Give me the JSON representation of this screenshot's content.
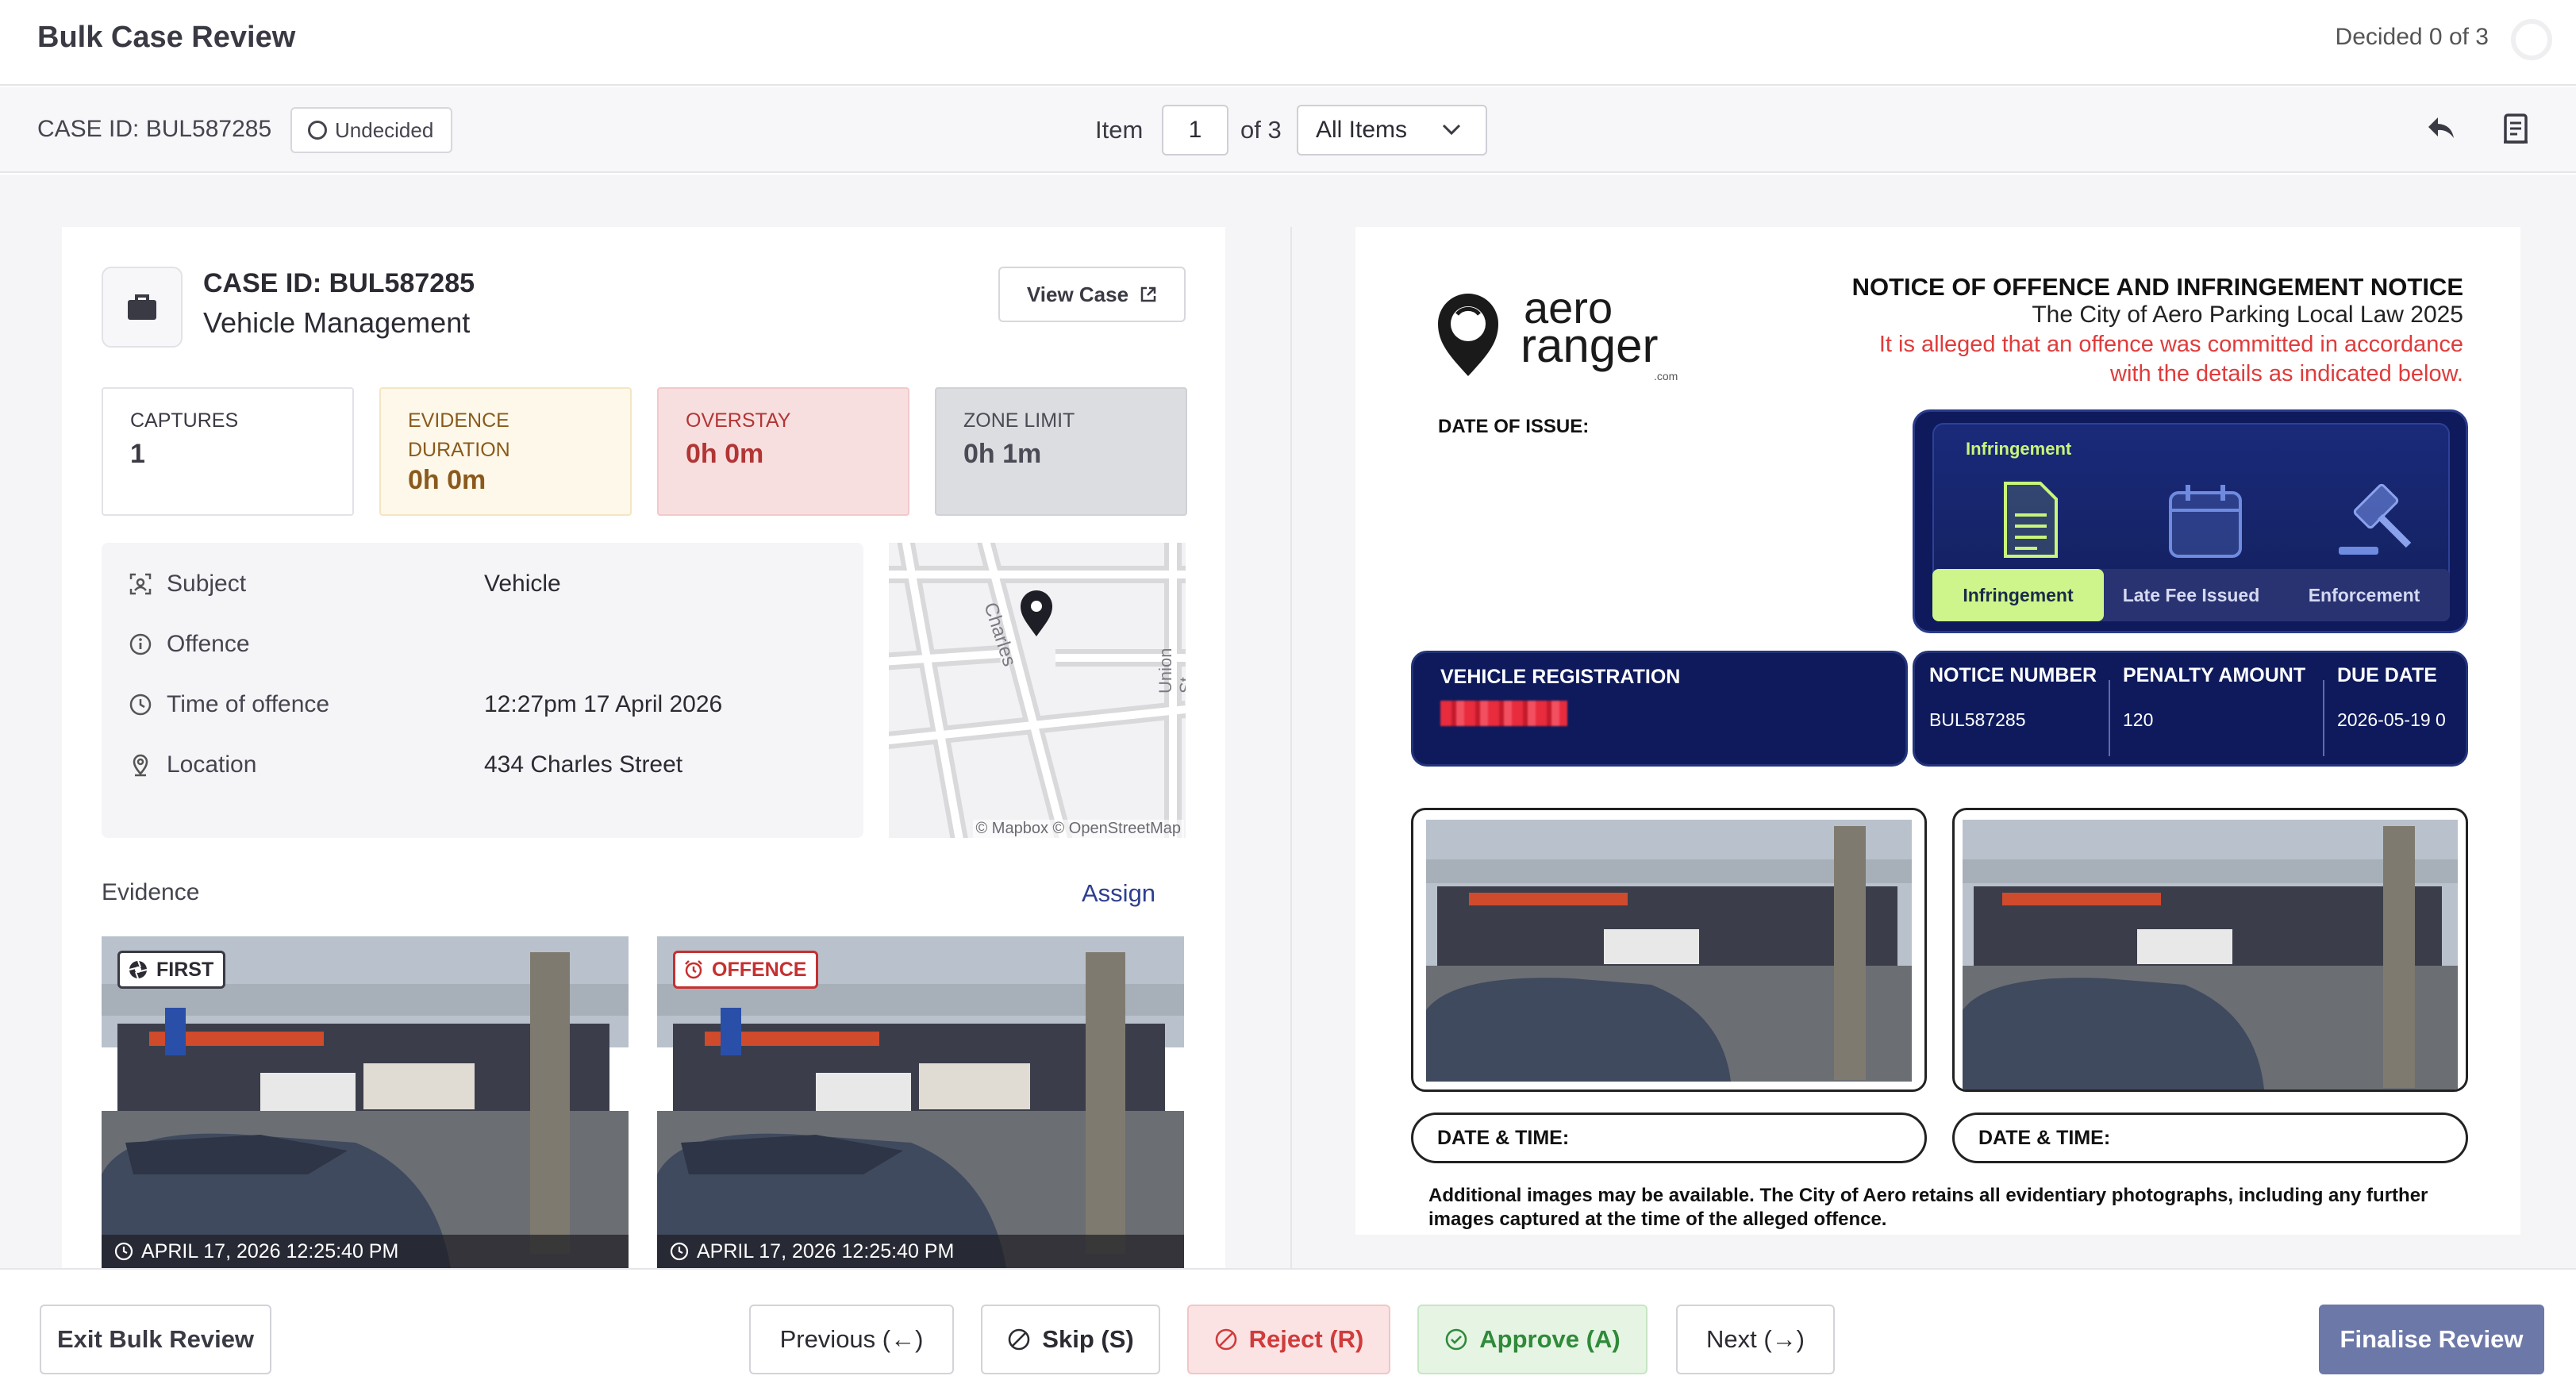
{
  "header": {
    "title": "Bulk Case Review",
    "decided_text": "Decided 0 of 3"
  },
  "subheader": {
    "case_id": "CASE ID: BUL587285",
    "status": "Undecided",
    "item_label": "Item",
    "item_value": "1",
    "of_label": "of 3",
    "filter_value": "All Items"
  },
  "case": {
    "id": "CASE ID: BUL587285",
    "category": "Vehicle Management",
    "view_case_label": "View Case",
    "stats": [
      {
        "label_lines": [
          "CAPTURES"
        ],
        "value": "1"
      },
      {
        "label_lines": [
          "EVIDENCE",
          "DURATION"
        ],
        "value": "0h 0m"
      },
      {
        "label_lines": [
          "OVERSTAY"
        ],
        "value": "0h 0m"
      },
      {
        "label_lines": [
          "ZONE LIMIT"
        ],
        "value": "0h 1m"
      }
    ],
    "details": [
      {
        "icon": "scan-icon",
        "label": "Subject",
        "value": "Vehicle"
      },
      {
        "icon": "info-icon",
        "label": "Offence",
        "value": ""
      },
      {
        "icon": "clock-icon",
        "label": "Time of offence",
        "value": "12:27pm 17 April 2026"
      },
      {
        "icon": "location-pin-icon",
        "label": "Location",
        "value": "434 Charles Street"
      }
    ],
    "map": {
      "streets": [
        "St",
        "Charles",
        "Union St"
      ],
      "attribution": "© Mapbox © OpenStreetMap"
    },
    "evidence_label": "Evidence",
    "assign_label": "Assign",
    "evidence": [
      {
        "tag": "FIRST",
        "timestamp": "APRIL 17, 2026 12:25:40 PM"
      },
      {
        "tag": "OFFENCE",
        "timestamp": "APRIL 17, 2026 12:25:40 PM"
      }
    ]
  },
  "notice": {
    "brand": {
      "line1": "aero",
      "line2": "ranger",
      "suffix": ".com"
    },
    "title": "NOTICE OF OFFENCE AND INFRINGEMENT NOTICE",
    "subtitle": "The City of Aero Parking Local Law 2025",
    "alert": "It is alleged that an offence was committed in accordance with the details as indicated below.",
    "date_of_issue_label": "DATE OF ISSUE:",
    "status_panel": {
      "title": "Infringement",
      "tabs": [
        "Infringement",
        "Late Fee Issued",
        "Enforcement"
      ],
      "active_tab": "Infringement"
    },
    "vehicle_registration_label": "VEHICLE REGISTRATION",
    "fees": [
      {
        "label": "NOTICE NUMBER",
        "value": "BUL587285"
      },
      {
        "label": "PENALTY AMOUNT",
        "value": "120"
      },
      {
        "label": "DUE DATE",
        "value": "2026-05-19 0"
      }
    ],
    "date_time_label": "DATE & TIME:",
    "footer_text": "Additional images may be available. The City of Aero retains all evidentiary photographs, including any further images captured at the time of the alleged offence."
  },
  "footer": {
    "exit_label": "Exit Bulk Review",
    "previous_label": "Previous (←)",
    "skip_label": "Skip (S)",
    "reject_label": "Reject (R)",
    "approve_label": "Approve (A)",
    "next_label": "Next (→)",
    "finalise_label": "Finalise Review"
  },
  "colors": {
    "reject": "#d03b3b",
    "approve": "#2f8a3a",
    "finalise": "#6c78a8",
    "notice_navy": "#0e1a5c",
    "alert_red": "#e03b3b",
    "active_tab": "#cdf58b"
  }
}
